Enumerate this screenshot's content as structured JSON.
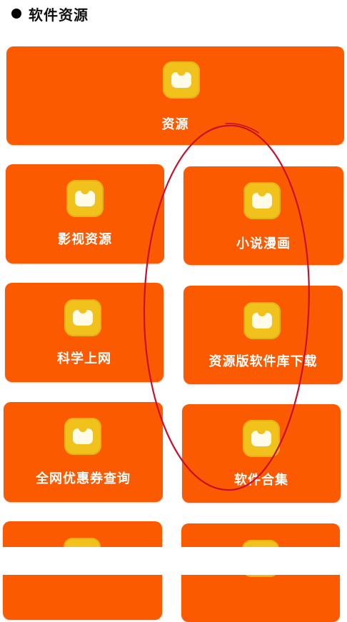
{
  "section": {
    "title": "软件资源"
  },
  "tiles": [
    {
      "label": "资源",
      "icon": "bag-icon"
    },
    {
      "label": "影视资源",
      "icon": "bag-icon"
    },
    {
      "label": "小说漫画",
      "icon": "bag-icon"
    },
    {
      "label": "科学上网",
      "icon": "bag-icon"
    },
    {
      "label": "资源版软件库下载",
      "icon": "bag-icon"
    },
    {
      "label": "全网优惠券查询",
      "icon": "bag-icon"
    },
    {
      "label": "软件合集",
      "icon": "bag-icon"
    },
    {
      "label": "",
      "icon": "bag-icon"
    },
    {
      "label": "",
      "icon": "bag-icon"
    }
  ],
  "colors": {
    "tile": "#fb5a00",
    "icon": "#f1c21c",
    "annotation": "#c8102e"
  }
}
